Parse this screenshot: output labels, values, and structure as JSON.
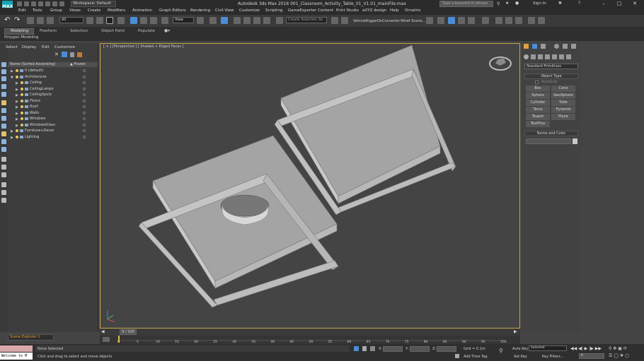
{
  "app": {
    "logo": "MAX",
    "title": "Autodesk 3ds Max 2016    001_Classroom_Activity_Table_01_V1.01_mainFile.max",
    "workspace": "Workspace: Default",
    "search_placeholder": "Type a keyword or phrase",
    "sign_in": "Sign In"
  },
  "menu": [
    "Edit",
    "Tools",
    "Group",
    "Views",
    "Create",
    "Modifiers",
    "Animation",
    "Graph Editors",
    "Rendering",
    "Civil View",
    "Customize",
    "Scripting",
    "GameExporter",
    "Content",
    "Print Studio",
    "aXYZ design",
    "Help",
    "Ornatrix"
  ],
  "toolbar": {
    "filter_value": "All",
    "view_value": "View",
    "selection_set_placeholder": "Create Selection Se",
    "plugins": [
      "VehicleRigger",
      "OnConverter",
      "Wisef Scene..."
    ]
  },
  "ribbon": {
    "tabs": [
      "Modeling",
      "Freeform",
      "Selection",
      "Object Paint",
      "Populate"
    ],
    "subtitle": "Polygon Modeling"
  },
  "scene_explorer": {
    "menu": [
      "Select",
      "Display",
      "Edit",
      "Customize"
    ],
    "col_name": "Name (Sorted Ascending)",
    "col_frozen": "▲ Frozen",
    "rows": [
      {
        "label": "0 (default)",
        "level": 0,
        "expanded": false
      },
      {
        "label": "Architecture",
        "level": 0,
        "expanded": true
      },
      {
        "label": "Ceiling",
        "level": 1,
        "expanded": false
      },
      {
        "label": "CeilingLamps",
        "level": 1,
        "expanded": false
      },
      {
        "label": "CeilingSpots",
        "level": 1,
        "expanded": false
      },
      {
        "label": "Floors",
        "level": 1,
        "expanded": false
      },
      {
        "label": "Roof",
        "level": 1,
        "expanded": false
      },
      {
        "label": "Walls",
        "level": 1,
        "expanded": false
      },
      {
        "label": "Windows",
        "level": 1,
        "expanded": false
      },
      {
        "label": "WindowsGlass",
        "level": 1,
        "expanded": false
      },
      {
        "label": "Furniture+Decor",
        "level": 0,
        "expanded": false
      },
      {
        "label": "Lighting",
        "level": 0,
        "expanded": false
      }
    ],
    "footer_label": "Scene Explorer 1"
  },
  "viewport": {
    "label": "[ + ] [Perspective ] [ Shaded + Edged Faces ]"
  },
  "command_panel": {
    "category": "Standard Primitives",
    "object_type_title": "Object Type",
    "autogrid": "AutoGrid",
    "buttons": [
      "Box",
      "Cone",
      "Sphere",
      "GeoSphere",
      "Cylinder",
      "Tube",
      "Torus",
      "Pyramid",
      "Teapot",
      "Plane",
      "TextPlus"
    ],
    "name_color_title": "Name and Color"
  },
  "timeline": {
    "position": "0 / 100",
    "ticks": [
      "0",
      "5",
      "10",
      "15",
      "20",
      "25",
      "30",
      "35",
      "40",
      "45",
      "50",
      "55",
      "60",
      "65",
      "70",
      "75",
      "80",
      "85",
      "90",
      "95",
      "100"
    ]
  },
  "status": {
    "maxscript": "Welcome to M",
    "selection": "None Selected",
    "prompt": "Click and drag to select and move objects",
    "x_label": "X:",
    "y_label": "Y:",
    "z_label": "Z:",
    "grid": "Grid = 0.1m",
    "add_time_tag": "Add Time Tag",
    "auto_key": "Auto Key",
    "set_key": "Set Key",
    "key_mode": "Selected",
    "key_filters": "Key Filters...",
    "frame": "0"
  },
  "colors": {
    "viewport_bg": "#444444",
    "viewport_border": "#c8a64a",
    "accent": "#14a6b3",
    "object_face": "#a8a8a8"
  }
}
